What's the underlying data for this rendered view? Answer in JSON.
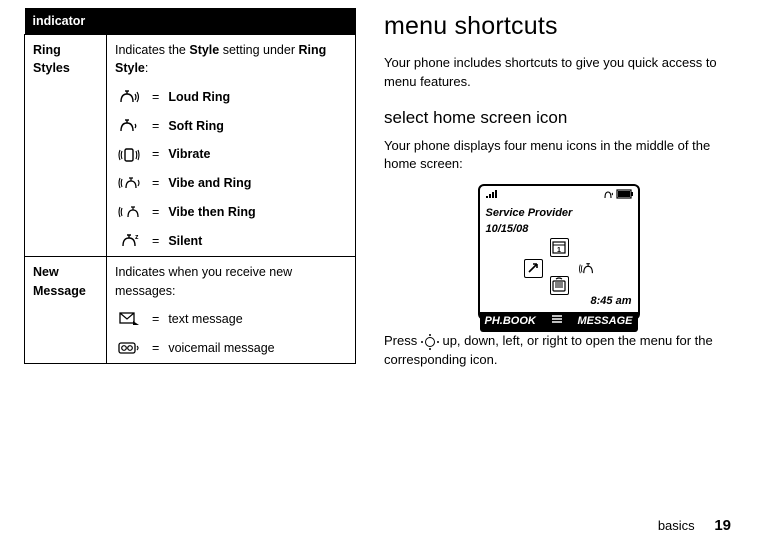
{
  "table": {
    "header": "indicator",
    "ring": {
      "label": "Ring Styles",
      "intro_pre": "Indicates the ",
      "intro_style": "Style",
      "intro_mid": " setting under ",
      "intro_ring_style": "Ring Style",
      "intro_post": ":",
      "items": [
        {
          "name": "Loud Ring"
        },
        {
          "name": "Soft Ring"
        },
        {
          "name": "Vibrate"
        },
        {
          "name": "Vibe and Ring"
        },
        {
          "name": "Vibe then Ring"
        },
        {
          "name": "Silent"
        }
      ]
    },
    "msg": {
      "label": "New Message",
      "intro": "Indicates when you receive new messages:",
      "items": [
        {
          "name": "text message"
        },
        {
          "name": "voicemail message"
        }
      ]
    }
  },
  "right": {
    "h1": "menu shortcuts",
    "p1": "Your phone includes shortcuts to give you quick access to menu features.",
    "h2": "select home screen icon",
    "p2": "Your phone displays four menu icons in the middle of the home screen:",
    "press_pre": "Press ",
    "press_post": " up, down, left, or right to open the menu for the corresponding icon."
  },
  "phone": {
    "provider": "Service Provider",
    "date": "10/15/08",
    "time": "8:45 am",
    "soft_left": "PH.BOOK",
    "soft_right": "MESSAGE"
  },
  "footer": {
    "section": "basics",
    "page": "19"
  },
  "eq": "="
}
